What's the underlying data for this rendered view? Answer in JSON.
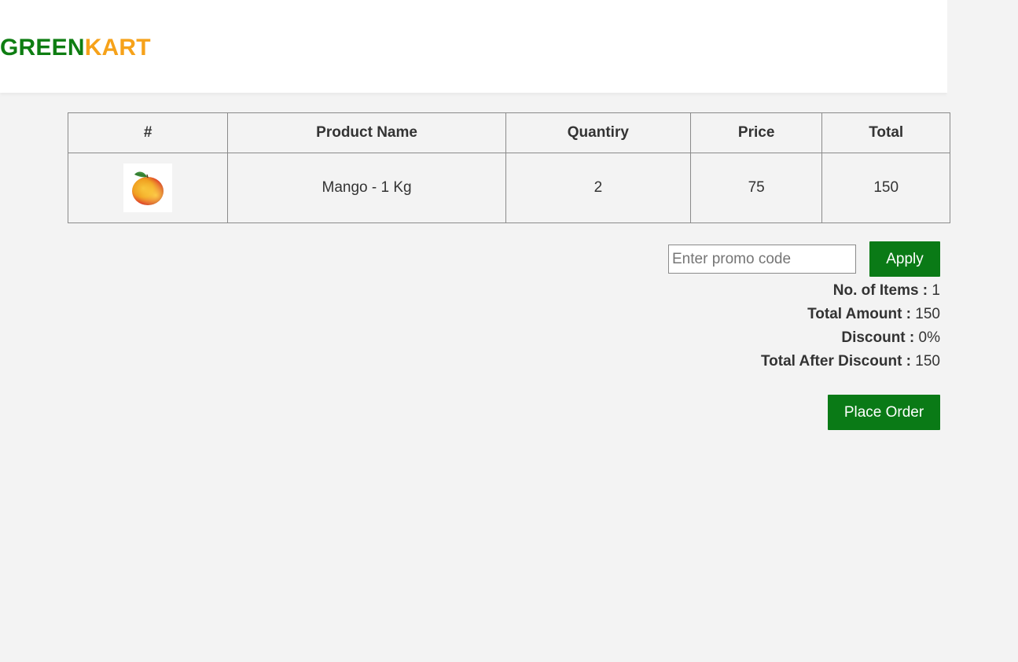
{
  "brand": {
    "part1": "GREEN",
    "part2": "KART",
    "color_primary": "#0e7d12",
    "color_accent": "#f6a21a"
  },
  "table": {
    "headers": [
      "#",
      "Product Name",
      "Quantiry",
      "Price",
      "Total"
    ],
    "rows": [
      {
        "image_icon": "mango-image",
        "product_name": "Mango - 1 Kg",
        "quantity": "2",
        "price": "75",
        "total": "150"
      }
    ]
  },
  "promo": {
    "placeholder": "Enter promo code",
    "value": "",
    "apply_label": "Apply"
  },
  "summary": {
    "items_label": "No. of Items :",
    "items_value": "1",
    "amount_label": "Total Amount :",
    "amount_value": "150",
    "discount_label": "Discount :",
    "discount_value": "0%",
    "after_label": "Total After Discount :",
    "after_value": "150"
  },
  "actions": {
    "place_order_label": "Place Order",
    "button_color": "#0a7a16"
  }
}
